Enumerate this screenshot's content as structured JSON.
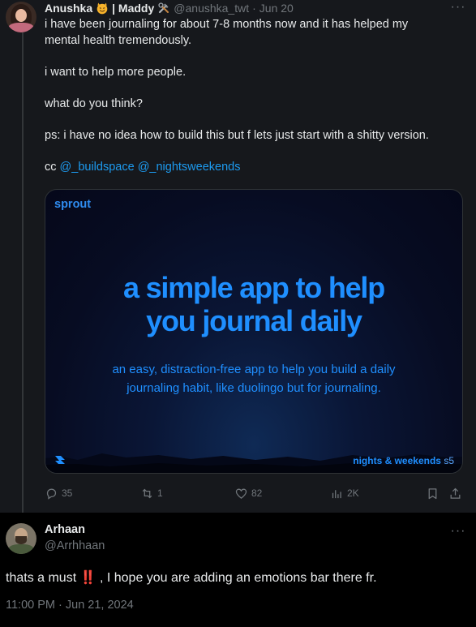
{
  "tweet": {
    "author_name": "Anushka",
    "author_name_2": "| Maddy",
    "handle": "@anushka_twt",
    "separator": "·",
    "date": "Jun 20",
    "lines": [
      "i have been journaling for about 7-8 months now and it has helped my",
      "mental health tremendously.",
      "",
      "i want to help more people.",
      "",
      "what do you think?",
      "",
      "ps: i have no idea how to build this but f lets just start with a shitty version.",
      ""
    ],
    "cc_prefix": "cc",
    "mentions": [
      "@_buildspace",
      "@_nightsweekends"
    ],
    "card": {
      "brand": "sprout",
      "headline_line1": "a simple app to help",
      "headline_line2": "you journal daily",
      "sub_line1": "an easy, distraction-free app to help you build a daily",
      "sub_line2": "journaling habit, like duolingo but for journaling.",
      "footer_brand": "nights & weekends",
      "footer_season": "s5"
    },
    "actions": {
      "replies": "35",
      "reposts": "1",
      "likes": "82",
      "views": "2K"
    },
    "colors": {
      "accent": "#1d9bf0",
      "muted": "#71767b",
      "card_text": "#1f8fff"
    }
  },
  "reply": {
    "author_name": "Arhaan",
    "handle": "@Arrhhaan",
    "text": "thats a must ‼️ , I hope you are adding an emotions bar there fr.",
    "timestamp": "11:00 PM · Jun 21, 2024"
  },
  "icons": [
    "more-icon",
    "reply-icon",
    "repost-icon",
    "like-icon",
    "views-icon",
    "bookmark-icon",
    "share-icon"
  ]
}
